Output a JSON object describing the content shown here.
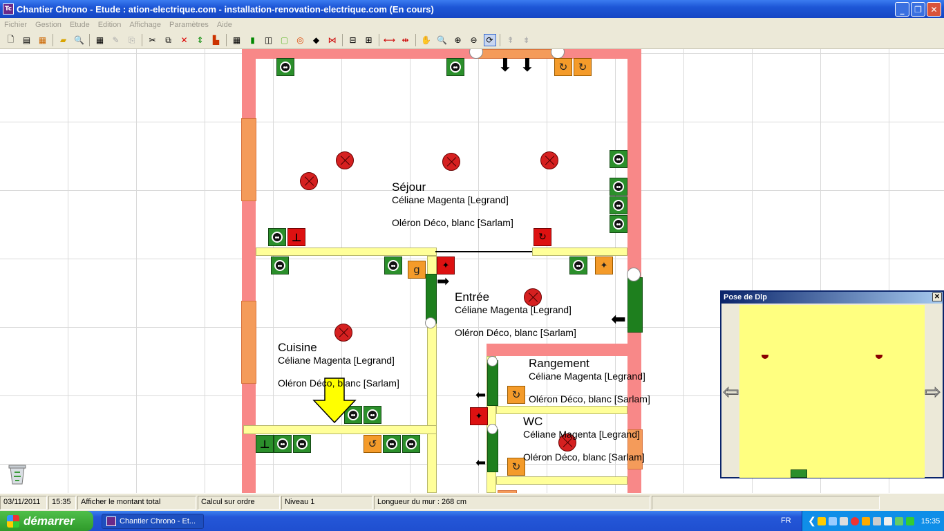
{
  "window": {
    "title": "Chantier Chrono - Etude : ation-electrique.com - installation-renovation-electrique.com (En cours)",
    "app_icon_text": "Tc",
    "buttons": {
      "minimize": "_",
      "maximize": "❐",
      "close": "✕"
    }
  },
  "menu": [
    "Fichier",
    "Gestion",
    "Etude",
    "Edition",
    "Affichage",
    "Paramètres",
    "Aide"
  ],
  "toolbar_icons": [
    "new-icon",
    "document-icon",
    "report-icon",
    "open-folder-icon",
    "print-preview-icon",
    "calculator-icon",
    "edit-icon",
    "copy-props-icon",
    "cut-icon",
    "copy-icon",
    "delete-icon",
    "move-vertical-icon",
    "bed-icon",
    "grid-icon",
    "door-icon",
    "wall-icon",
    "rectangle-icon",
    "circle-shape-icon",
    "fill-icon",
    "stretch-icon",
    "align-icon",
    "align2-icon",
    "dimension-icon",
    "measure-icon",
    "hand-icon",
    "zoom-icon",
    "zoom-in-icon",
    "zoom-out-icon",
    "refresh-zoom-icon",
    "level-up-icon",
    "level-down-icon"
  ],
  "rooms": [
    {
      "name": "Séjour",
      "line1": "Céliane Magenta [Legrand]",
      "line2": "Oléron Déco, blanc [Sarlam]"
    },
    {
      "name": "Entrée",
      "line1": "Céliane Magenta [Legrand]",
      "line2": "Oléron Déco, blanc [Sarlam]"
    },
    {
      "name": "Cuisine",
      "line1": "Céliane Magenta [Legrand]",
      "line2": "Oléron Déco, blanc [Sarlam]"
    },
    {
      "name": "Rangement",
      "line1": "Céliane Magenta [Legrand]",
      "line2": "Oléron Déco, blanc [Sarlam]"
    },
    {
      "name": "WC",
      "line1": "Céliane Magenta [Legrand]",
      "line2": "Oléron Déco, blanc [Sarlam]"
    }
  ],
  "panel": {
    "title": "Pose de Dlp",
    "close": "✕"
  },
  "status": {
    "date": "03/11/2011",
    "time": "15:35",
    "show_total": "Afficher le montant total",
    "calc": "Calcul sur ordre",
    "level": "Niveau 1",
    "wall_length": "Longueur du mur : 268 cm"
  },
  "taskbar": {
    "start": "démarrer",
    "task": "Chantier Chrono - Et...",
    "lang": "FR",
    "clock": "15:35"
  },
  "colors": {
    "wall": "#f88888",
    "light_wall": "#ffff99",
    "socket": "#2b8f2b",
    "switch": "#f49b2a",
    "light": "#d52020"
  }
}
